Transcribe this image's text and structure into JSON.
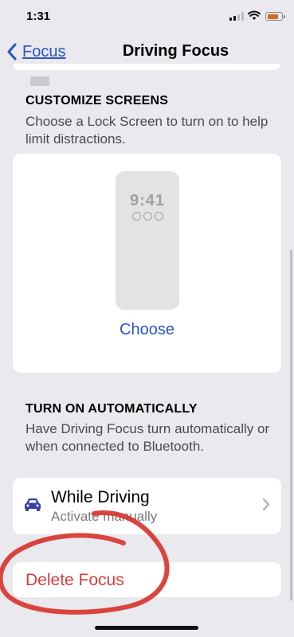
{
  "status_bar": {
    "time": "1:31"
  },
  "nav": {
    "back_label": "Focus",
    "title": "Driving Focus"
  },
  "customize": {
    "header": "CUSTOMIZE SCREENS",
    "description": "Choose a Lock Screen to turn on to help limit distractions.",
    "preview_time": "9:41",
    "choose_label": "Choose"
  },
  "automation": {
    "header": "TURN ON AUTOMATICALLY",
    "description": "Have Driving Focus turn automatically or when connected to Bluetooth.",
    "row_title": "While Driving",
    "row_subtitle": "Activate manually"
  },
  "delete": {
    "label": "Delete Focus"
  },
  "colors": {
    "accent": "#2b54c7",
    "destructive": "#d93d3d",
    "annotation": "#d8352f",
    "background": "#e9e9ee",
    "battery": "#d06a1d"
  },
  "icons": [
    "chevron-left-icon",
    "car-icon",
    "chevron-right-icon",
    "wifi-icon",
    "cellular-signal-icon",
    "battery-icon"
  ]
}
